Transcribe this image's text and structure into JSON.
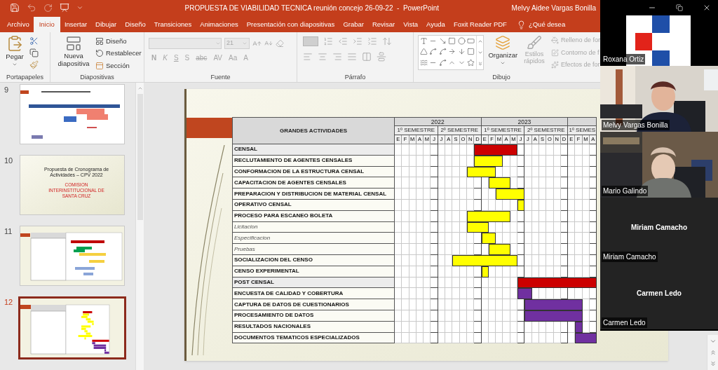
{
  "title_bar": {
    "title": "PROPUESTA DE VIABILIDAD TECNICA reunión concejo 26-09-22  -  PowerPoint",
    "user": "Melvy Aidee Vargas Bonilla"
  },
  "tabs": [
    {
      "label": "Archivo",
      "selected": false
    },
    {
      "label": "Inicio",
      "selected": true
    },
    {
      "label": "Insertar",
      "selected": false
    },
    {
      "label": "Dibujar",
      "selected": false
    },
    {
      "label": "Diseño",
      "selected": false
    },
    {
      "label": "Transiciones",
      "selected": false
    },
    {
      "label": "Animaciones",
      "selected": false
    },
    {
      "label": "Presentación con diapositivas",
      "selected": false
    },
    {
      "label": "Grabar",
      "selected": false
    },
    {
      "label": "Revisar",
      "selected": false
    },
    {
      "label": "Vista",
      "selected": false
    },
    {
      "label": "Ayuda",
      "selected": false
    },
    {
      "label": "Foxit Reader PDF",
      "selected": false
    }
  ],
  "tell_me": {
    "placeholder": "¿Qué desea"
  },
  "ribbon": {
    "clipboard": {
      "label": "Portapapeles",
      "paste": "Pegar"
    },
    "slides": {
      "label": "Diapositivas",
      "new_slide": "Nueva diapositiva",
      "items": [
        "Diseño",
        "Restablecer",
        "Sección"
      ]
    },
    "font": {
      "label": "Fuente",
      "disabled": true,
      "size": "21",
      "format_buttons": [
        "N",
        "K",
        "S",
        "S",
        "abc",
        "AV",
        "Aa",
        "A"
      ]
    },
    "paragraph": {
      "label": "Párrafo"
    },
    "drawing": {
      "label": "Dibujo",
      "arrange": "Organizar",
      "styles": {
        "label": "Estilos rápidos",
        "disabled": true
      },
      "items": [
        {
          "label": "Relleno de for",
          "disabled": true
        },
        {
          "label": "Contorno de f",
          "disabled": true
        },
        {
          "label": "Efectos de for",
          "disabled": true
        }
      ]
    }
  },
  "thumbnails": [
    {
      "number": "9",
      "selected": false,
      "kind": "schedule"
    },
    {
      "number": "10",
      "selected": false,
      "kind": "title",
      "title": "Propuesta de Cronograma de Actividades – CPV 2022",
      "subtitle": "COMISION INTERINSTITUCIONAL DE SANTA CRUZ"
    },
    {
      "number": "11",
      "selected": false,
      "kind": "gantt"
    },
    {
      "number": "12",
      "selected": true,
      "kind": "current"
    }
  ],
  "slide": {
    "table": {
      "header": "GRANDES ACTIVIDADES",
      "years": [
        {
          "label": "2022",
          "semesters": [
            {
              "label": "1º SEMESTRE",
              "months": [
                "E",
                "F",
                "M",
                "A",
                "M",
                "J"
              ]
            },
            {
              "label": "2º SEMESTRE",
              "months": [
                "J",
                "A",
                "S",
                "O",
                "N",
                "D"
              ]
            }
          ]
        },
        {
          "label": "2023",
          "semesters": [
            {
              "label": "1º SEMESTRE",
              "months": [
                "E",
                "F",
                "M",
                "A",
                "M",
                "J"
              ]
            },
            {
              "label": "2º SEMESTRE",
              "months": [
                "J",
                "A",
                "S",
                "O",
                "N",
                "D"
              ]
            }
          ]
        },
        {
          "semesters": [
            {
              "label": "1º SEMES",
              "months": [
                "E",
                "F",
                "M",
                "A"
              ]
            }
          ]
        }
      ],
      "rows": [
        {
          "label": "CENSAL",
          "kind": "section",
          "color": "#cc0000",
          "cells": [
            false,
            false,
            false,
            false,
            false,
            false,
            false,
            false,
            false,
            false,
            false,
            true,
            true,
            true,
            true,
            true,
            true,
            false,
            false,
            false,
            false,
            false,
            false,
            false,
            false,
            false,
            false,
            false
          ]
        },
        {
          "label": "RECLUTAMIENTO DE AGENTES CENSALES",
          "kind": "task",
          "color": "#ffff00",
          "cells": [
            false,
            false,
            false,
            false,
            false,
            false,
            false,
            false,
            false,
            false,
            false,
            true,
            true,
            true,
            true,
            false,
            false,
            false,
            false,
            false,
            false,
            false,
            false,
            false,
            false,
            false,
            false,
            false
          ]
        },
        {
          "label": "CONFORMACION DE LA ESTRUCTURA CENSAL",
          "kind": "task",
          "color": "#ffff00",
          "cells": [
            false,
            false,
            false,
            false,
            false,
            false,
            false,
            false,
            false,
            false,
            true,
            true,
            true,
            true,
            false,
            false,
            false,
            false,
            false,
            false,
            false,
            false,
            false,
            false,
            false,
            false,
            false,
            false
          ]
        },
        {
          "label": "CAPACITACION DE AGENTES CENSALES",
          "kind": "task",
          "color": "#ffff00",
          "cells": [
            false,
            false,
            false,
            false,
            false,
            false,
            false,
            false,
            false,
            false,
            false,
            false,
            false,
            true,
            true,
            true,
            false,
            false,
            false,
            false,
            false,
            false,
            false,
            false,
            false,
            false,
            false,
            false
          ]
        },
        {
          "label": "PREPARACION Y DISTRIBUCION DE MATERIAL CENSAL",
          "kind": "task",
          "color": "#ffff00",
          "cells": [
            false,
            false,
            false,
            false,
            false,
            false,
            false,
            false,
            false,
            false,
            false,
            false,
            false,
            false,
            true,
            true,
            true,
            true,
            false,
            false,
            false,
            false,
            false,
            false,
            false,
            false,
            false,
            false
          ]
        },
        {
          "label": "OPERATIVO CENSAL",
          "kind": "task",
          "color": "#ffff00",
          "cells": [
            false,
            false,
            false,
            false,
            false,
            false,
            false,
            false,
            false,
            false,
            false,
            false,
            false,
            false,
            false,
            false,
            false,
            true,
            false,
            false,
            false,
            false,
            false,
            false,
            false,
            false,
            false,
            false
          ]
        },
        {
          "label": "PROCESO PARA ESCANEO BOLETA",
          "kind": "task",
          "color": "#ffff00",
          "cells": [
            false,
            false,
            false,
            false,
            false,
            false,
            false,
            false,
            false,
            false,
            true,
            true,
            true,
            true,
            true,
            true,
            false,
            false,
            false,
            false,
            false,
            false,
            false,
            false,
            false,
            false,
            false,
            false
          ]
        },
        {
          "label": "Licitacion",
          "kind": "subtask",
          "color": "#ffff00",
          "cells": [
            false,
            false,
            false,
            false,
            false,
            false,
            false,
            false,
            false,
            false,
            true,
            true,
            true,
            false,
            false,
            false,
            false,
            false,
            false,
            false,
            false,
            false,
            false,
            false,
            false,
            false,
            false,
            false
          ]
        },
        {
          "label": "Especificacion",
          "kind": "subtask",
          "color": "#ffff00",
          "cells": [
            false,
            false,
            false,
            false,
            false,
            false,
            false,
            false,
            false,
            false,
            false,
            false,
            true,
            true,
            false,
            false,
            false,
            false,
            false,
            false,
            false,
            false,
            false,
            false,
            false,
            false,
            false,
            false
          ]
        },
        {
          "label": "Pruebas",
          "kind": "subtask",
          "color": "#ffff00",
          "cells": [
            false,
            false,
            false,
            false,
            false,
            false,
            false,
            false,
            false,
            false,
            false,
            false,
            false,
            true,
            true,
            true,
            false,
            false,
            false,
            false,
            false,
            false,
            false,
            false,
            false,
            false,
            false,
            false
          ]
        },
        {
          "label": "SOCIALIZACION DEL CENSO",
          "kind": "task",
          "color": "#ffff00",
          "cells": [
            false,
            false,
            false,
            false,
            false,
            false,
            false,
            false,
            true,
            true,
            true,
            true,
            true,
            true,
            true,
            true,
            true,
            false,
            false,
            false,
            false,
            false,
            false,
            false,
            false,
            false,
            false,
            false
          ]
        },
        {
          "label": "CENSO EXPERIMENTAL",
          "kind": "task",
          "color": "#ffff00",
          "cells": [
            false,
            false,
            false,
            false,
            false,
            false,
            false,
            false,
            false,
            false,
            false,
            false,
            true,
            false,
            false,
            false,
            false,
            false,
            false,
            false,
            false,
            false,
            false,
            false,
            false,
            false,
            false,
            false
          ]
        },
        {
          "label": "POST CENSAL",
          "kind": "section",
          "color": "#cc0000",
          "cells": [
            false,
            false,
            false,
            false,
            false,
            false,
            false,
            false,
            false,
            false,
            false,
            false,
            false,
            false,
            false,
            false,
            false,
            true,
            true,
            true,
            true,
            true,
            true,
            true,
            true,
            true,
            true,
            true
          ]
        },
        {
          "label": "ENCUESTA DE CALIDAD Y COBERTURA",
          "kind": "task",
          "color": "#7030a0",
          "cells": [
            false,
            false,
            false,
            false,
            false,
            false,
            false,
            false,
            false,
            false,
            false,
            false,
            false,
            false,
            false,
            false,
            false,
            true,
            true,
            false,
            false,
            false,
            false,
            false,
            false,
            false,
            false,
            false
          ]
        },
        {
          "label": "CAPTURA DE DATOS DE CUESTIONARIOS",
          "kind": "task",
          "color": "#7030a0",
          "cells": [
            false,
            false,
            false,
            false,
            false,
            false,
            false,
            false,
            false,
            false,
            false,
            false,
            false,
            false,
            false,
            false,
            false,
            false,
            true,
            true,
            true,
            true,
            true,
            true,
            true,
            true,
            false,
            false
          ]
        },
        {
          "label": "PROCESAMIENTO DE DATOS",
          "kind": "task",
          "color": "#7030a0",
          "cells": [
            false,
            false,
            false,
            false,
            false,
            false,
            false,
            false,
            false,
            false,
            false,
            false,
            false,
            false,
            false,
            false,
            false,
            false,
            true,
            true,
            true,
            true,
            true,
            true,
            true,
            true,
            false,
            false
          ]
        },
        {
          "label": "RESULTADOS NACIONALES",
          "kind": "task",
          "color": "#7030a0",
          "cells": [
            false,
            false,
            false,
            false,
            false,
            false,
            false,
            false,
            false,
            false,
            false,
            false,
            false,
            false,
            false,
            false,
            false,
            false,
            false,
            false,
            false,
            false,
            false,
            false,
            false,
            true,
            false,
            false
          ]
        },
        {
          "label": "DOCUMENTOS TEMATICOS ESPECIALIZADOS",
          "kind": "task",
          "color": "#7030a0",
          "cells": [
            false,
            false,
            false,
            false,
            false,
            false,
            false,
            false,
            false,
            false,
            false,
            false,
            false,
            false,
            false,
            false,
            false,
            false,
            false,
            false,
            false,
            false,
            false,
            false,
            false,
            true,
            true,
            true
          ]
        }
      ]
    }
  },
  "participants": [
    {
      "kind": "logo",
      "caption": "Roxana Ortiz"
    },
    {
      "kind": "video",
      "caption": "Melvy Vargas Bonilla"
    },
    {
      "kind": "video",
      "caption": "Mario Galindo"
    },
    {
      "kind": "avatar",
      "name": "Miriam Camacho",
      "caption": "Miriam Camacho"
    },
    {
      "kind": "avatar",
      "name": "Carmen Ledo",
      "caption": "Carmen Ledo"
    }
  ]
}
